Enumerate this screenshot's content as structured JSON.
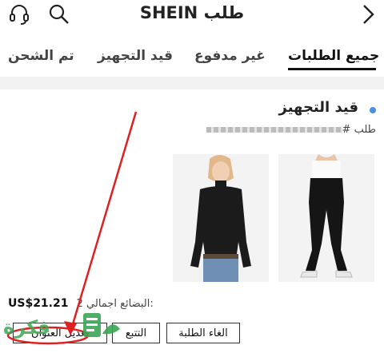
{
  "header": {
    "title": "طلب SHEIN"
  },
  "tabs": [
    {
      "label": "جميع الطلبات",
      "active": true
    },
    {
      "label": "غير مدفوع"
    },
    {
      "label": "قيد التجهيز"
    },
    {
      "label": "تم الشحن"
    }
  ],
  "order": {
    "status": "قيد التجهيز",
    "status_color": "#4a90e2",
    "order_number_label": "طلب #",
    "items_summary": "2 البضائع اجمالي:",
    "total": "US$21.21"
  },
  "products": [
    {
      "name": "black-leggings"
    },
    {
      "name": "black-turtleneck-top"
    }
  ],
  "buttons": {
    "cancel": "الغاء الطلبة",
    "track": "التتبع",
    "edit_address": "تعديل العنوان"
  },
  "watermark": {
    "text": "فكرة"
  },
  "colors": {
    "annotation_red": "#e02020",
    "watermark_green": "#3aa655"
  }
}
